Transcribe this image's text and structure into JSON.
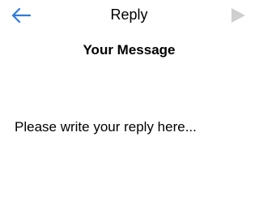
{
  "header": {
    "title": "Reply",
    "back_icon": "arrow-left-icon",
    "send_icon": "send-triangle-icon"
  },
  "main": {
    "heading": "Your Message",
    "reply_field": {
      "value": "",
      "placeholder": "Please write your reply here..."
    }
  },
  "colors": {
    "accent": "#2f7bd8",
    "disabled_icon": "#cfcfcf",
    "text": "#000000",
    "background": "#ffffff"
  }
}
